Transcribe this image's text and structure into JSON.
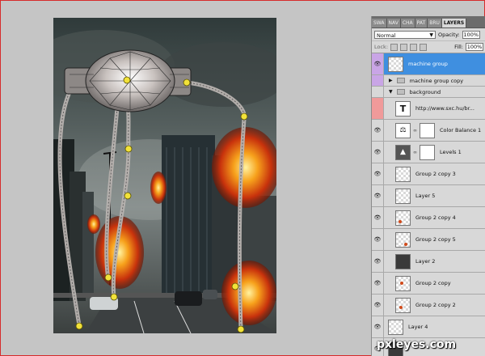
{
  "panel": {
    "tabs": [
      "SWA",
      "NAV",
      "CHA",
      "PAT",
      "BRU",
      "LAYERS"
    ],
    "blend_mode": "Normal",
    "opacity_label": "Opacity:",
    "opacity_value": "100%",
    "lock_label": "Lock:",
    "fill_label": "Fill:",
    "fill_value": "100%"
  },
  "layers": [
    {
      "name": "machine group",
      "type": "layer",
      "selected": true,
      "eye": "purple",
      "thumb": "checker"
    },
    {
      "name": "machine group copy",
      "type": "group",
      "collapsed": true,
      "eye": "purple"
    },
    {
      "name": "background",
      "type": "group",
      "collapsed": false,
      "eye": "none"
    },
    {
      "name": "http://www.sxc.hu/br...",
      "type": "text",
      "eye": "pink",
      "thumb": "T"
    },
    {
      "name": "Color Balance 1",
      "type": "adjustment",
      "eye": "visible",
      "icon": "scale-icon"
    },
    {
      "name": "Levels 1",
      "type": "adjustment",
      "eye": "visible",
      "icon": "levels-icon"
    },
    {
      "name": "Group 2 copy 3",
      "type": "layer",
      "eye": "visible",
      "thumb": "checker"
    },
    {
      "name": "Layer 5",
      "type": "layer",
      "eye": "visible",
      "thumb": "checker"
    },
    {
      "name": "Group 2 copy 4",
      "type": "layer",
      "eye": "visible",
      "thumb": "checker-dot"
    },
    {
      "name": "Group 2 copy 5",
      "type": "layer",
      "eye": "visible",
      "thumb": "checker-dot"
    },
    {
      "name": "Layer 2",
      "type": "layer",
      "eye": "visible",
      "thumb": "photo"
    },
    {
      "name": "Group 2 copy",
      "type": "layer",
      "eye": "visible",
      "thumb": "checker-dot"
    },
    {
      "name": "Group 2 copy 2",
      "type": "layer",
      "eye": "visible",
      "thumb": "checker-dot"
    },
    {
      "name": "Layer 4",
      "type": "layer",
      "eye": "visible",
      "thumb": "checker"
    },
    {
      "name": "",
      "type": "layer",
      "eye": "visible",
      "thumb": "photo"
    }
  ],
  "watermark": "pxleyes.com",
  "colors": {
    "selected_row": "#3f8fe0",
    "purple_tag": "#c9a5e6",
    "pink_tag": "#f09a9a",
    "frame_border": "#d62b2b",
    "anchor_point": "#f2e23a"
  }
}
